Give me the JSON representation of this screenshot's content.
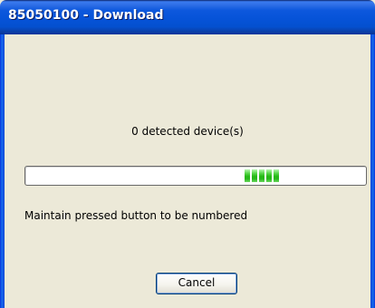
{
  "window": {
    "title": "85050100 - Download"
  },
  "status": {
    "detected_text": "0 detected device(s)",
    "progress_fraction": 0.72,
    "progress_chunks": 5,
    "hint_text": "Maintain pressed button to be numbered"
  },
  "buttons": {
    "cancel_label": "Cancel"
  },
  "colors": {
    "titlebar": "#0653d8",
    "progress_chunk": "#26b916",
    "dialog_background": "#ece9d8"
  }
}
